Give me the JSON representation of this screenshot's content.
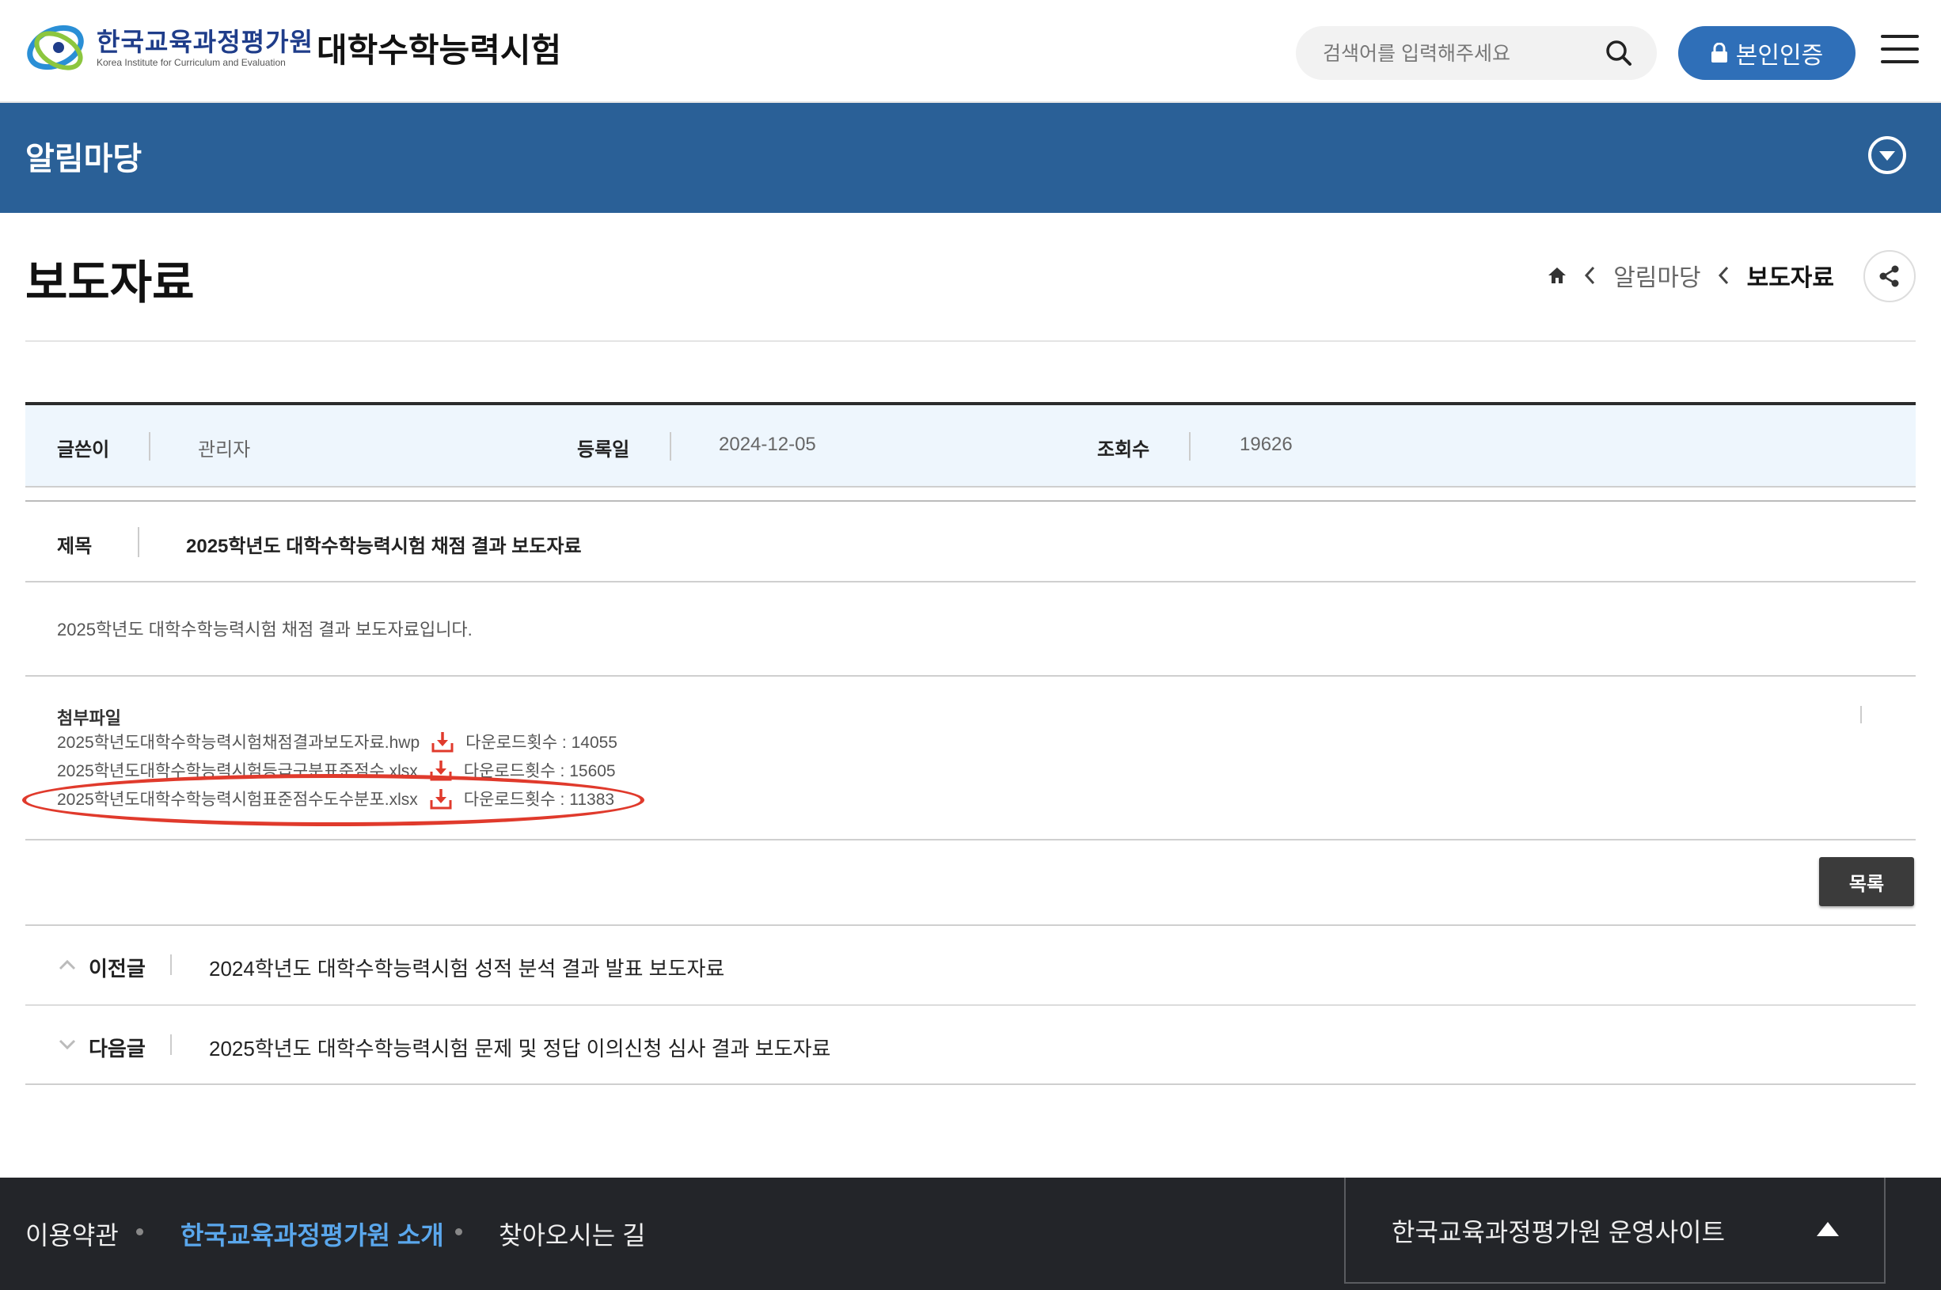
{
  "header": {
    "logo_name": "한국교육과정평가원",
    "logo_subtitle": "Korea Institute for Curriculum and Evaluation",
    "site_title": "대학수학능력시험",
    "search_placeholder": "검색어를 입력해주세요",
    "auth_button": "본인인증"
  },
  "section_bar": {
    "title": "알림마당"
  },
  "page": {
    "title": "보도자료",
    "breadcrumb": [
      "알림마당",
      "보도자료"
    ]
  },
  "post": {
    "writer_label": "글쓴이",
    "writer": "관리자",
    "date_label": "등록일",
    "date": "2024-12-05",
    "views_label": "조회수",
    "views": "19626",
    "subject_label": "제목",
    "subject": "2025학년도 대학수학능력시험 채점 결과 보도자료",
    "content": "2025학년도 대학수학능력시험 채점 결과 보도자료입니다.",
    "attachments_label": "첨부파일",
    "attachments": [
      {
        "name": "2025학년도대학수학능력시험채점결과보도자료.hwp",
        "downloads": "다운로드횟수 : 14055"
      },
      {
        "name": "2025학년도대학수학능력시험등급구분표준점수.xlsx",
        "downloads": "다운로드횟수 : 15605"
      },
      {
        "name": "2025학년도대학수학능력시험표준점수도수분포.xlsx",
        "downloads": "다운로드횟수 : 11383"
      }
    ],
    "list_button": "목록"
  },
  "nav": {
    "prev_label": "이전글",
    "prev_title": "2024학년도 대학수학능력시험 성적 분석 결과 발표 보도자료",
    "next_label": "다음글",
    "next_title": "2025학년도 대학수학능력시험 문제 및 정답 이의신청 심사 결과 보도자료"
  },
  "footer": {
    "links": [
      "이용약관",
      "한국교육과정평가원 소개",
      "찾아오시는 길"
    ],
    "site_select": "한국교육과정평가원 운영사이트"
  },
  "colors": {
    "primary_blue": "#2a6097",
    "button_blue": "#2f6fb8",
    "highlight_red": "#e03a2c",
    "footer_bg": "#232529",
    "footer_highlight": "#5aa7ec"
  }
}
